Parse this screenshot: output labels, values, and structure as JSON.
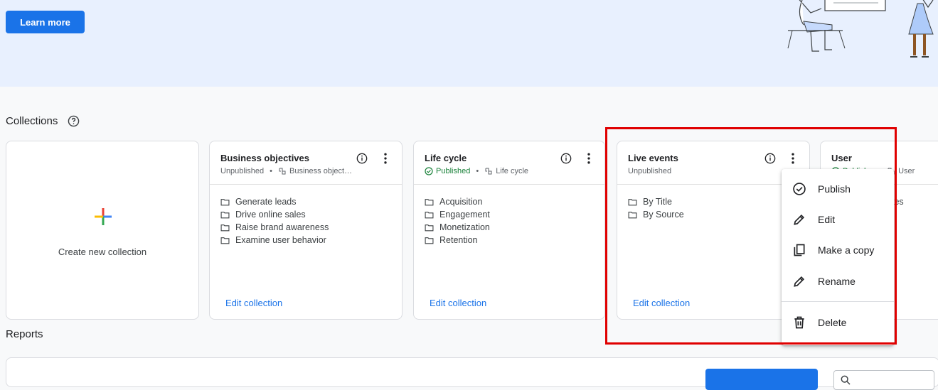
{
  "banner": {
    "learn_more": "Learn more"
  },
  "collections": {
    "title": "Collections",
    "create_label": "Create new collection",
    "cards": [
      {
        "title": "Business objectives",
        "status": "Unpublished",
        "source": "Business object…",
        "items": [
          "Generate leads",
          "Drive online sales",
          "Raise brand awareness",
          "Examine user behavior"
        ],
        "edit": "Edit collection"
      },
      {
        "title": "Life cycle",
        "status": "Published",
        "source": "Life cycle",
        "items": [
          "Acquisition",
          "Engagement",
          "Monetization",
          "Retention"
        ],
        "edit": "Edit collection"
      },
      {
        "title": "Live events",
        "status": "Unpublished",
        "items": [
          "By Title",
          "By Source"
        ],
        "edit": "Edit collection"
      },
      {
        "title": "User",
        "status": "Publishe",
        "source": "User",
        "items": [
          "tes"
        ]
      }
    ]
  },
  "menu": {
    "publish": "Publish",
    "edit": "Edit",
    "copy": "Make a copy",
    "rename": "Rename",
    "delete": "Delete"
  },
  "reports": {
    "title": "Reports"
  },
  "colors": {
    "accent": "#1a73e8",
    "published": "#188038",
    "highlight": "#e00000"
  }
}
